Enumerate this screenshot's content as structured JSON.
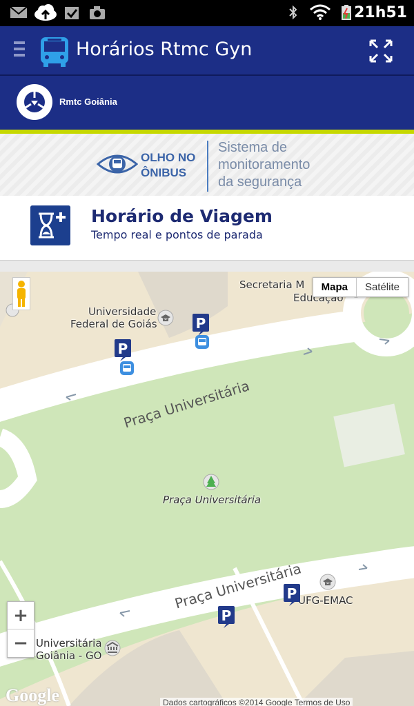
{
  "status_bar": {
    "time": "21h51"
  },
  "app_bar": {
    "title": "Horários Rtmc Gyn"
  },
  "brand_bar": {
    "name": "Rmtc Goiânia"
  },
  "banner": {
    "brand_line1": "OLHO NO",
    "brand_line2": "ÔNIBUS",
    "tagline_line1": "Sistema de",
    "tagline_line2": "monitoramento",
    "tagline_line3": "da segurança"
  },
  "header": {
    "title": "Horário de Viagem",
    "subtitle": "Tempo real e pontos de parada"
  },
  "map": {
    "map_type_options": [
      "Mapa",
      "Satélite"
    ],
    "selected_map_type": "Mapa",
    "labels": {
      "secretaria_1": "Secretaria M",
      "secretaria_2": "Educação",
      "ufg_1": "Universidade",
      "ufg_2": "Federal de Goiás",
      "road_top": "Praça Universitária",
      "park": "Praça Universitária",
      "road_bottom": "Praça Universitária",
      "ufg_emac": "UFG-EMAC",
      "univ_goiania_1": "Universitária",
      "univ_goiania_2": "Goiânia - GO"
    },
    "zoom_in": "+",
    "zoom_out": "−",
    "google_logo": "Google",
    "attribution": "Dados cartográficos ©2014 Google   Termos de Uso"
  }
}
